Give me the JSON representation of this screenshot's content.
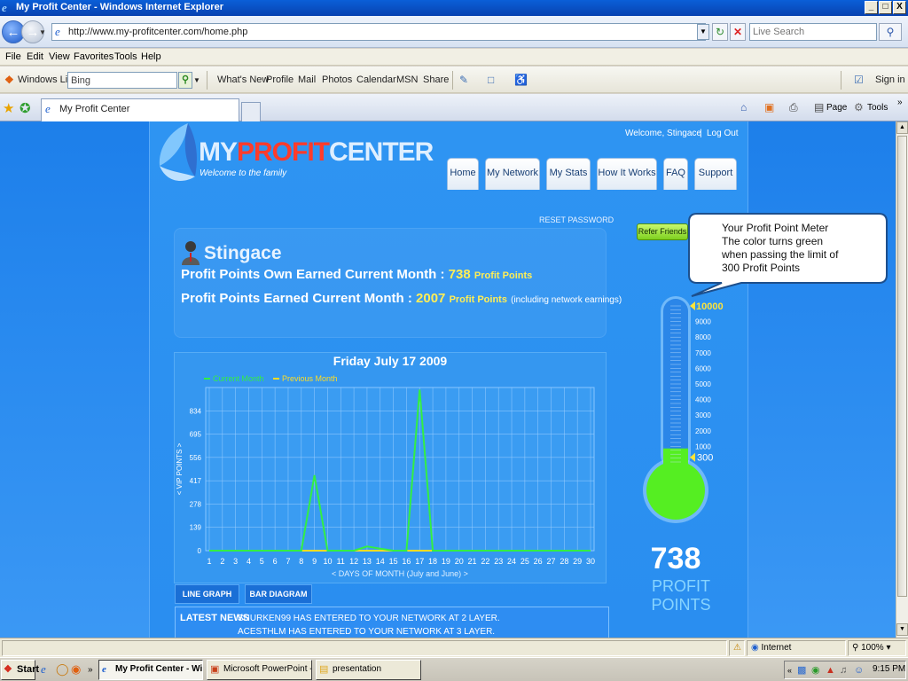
{
  "window": {
    "title": "My Profit Center - Windows Internet Explorer",
    "minimize": "_",
    "restore": "□",
    "close": "X"
  },
  "address": {
    "url": "http://www.my-profitcenter.com/home.php",
    "search_placeholder": "Live Search"
  },
  "menu": [
    "File",
    "Edit",
    "View",
    "Favorites",
    "Tools",
    "Help"
  ],
  "toolbar": {
    "windows_live": "Windows Live",
    "search_value": "Bing",
    "links": [
      "What's New",
      "Profile",
      "Mail",
      "Photos",
      "Calendar",
      "MSN",
      "Share"
    ],
    "sign_in": "Sign in"
  },
  "tabs": {
    "active": "My Profit Center",
    "page": "Page",
    "tools": "Tools"
  },
  "site": {
    "welcome": "Welcome, Stingace",
    "logout": "Log Out",
    "logo_part1": "MY",
    "logo_part2": "PROFIT",
    "logo_part3": "CENTER",
    "tagline": "Welcome to the family",
    "nav": [
      "Home",
      "My Network",
      "My Stats",
      "How It Works",
      "FAQ",
      "Support"
    ],
    "reset_password": "RESET PASSWORD",
    "refer_friends": "Refer Friends"
  },
  "stats": {
    "username": "Stingace",
    "own_label": "Profit Points Own Earned Current Month :",
    "own_value": "738",
    "own_unit": "Profit Points",
    "total_label": "Profit Points Earned Current Month :",
    "total_value": "2007",
    "total_unit": "Profit Points",
    "total_note": "(including network earnings)"
  },
  "chart_tabs": [
    "LINE GRAPH",
    "BAR DIAGRAM"
  ],
  "news": {
    "label": "LATEST NEWS",
    "items": [
      "SNURKEN99 HAS ENTERED TO YOUR NETWORK AT 2 LAYER.",
      "ACESTHLM HAS ENTERED TO YOUR NETWORK AT 3 LAYER."
    ]
  },
  "meter": {
    "value": "738",
    "label": "PROFIT POINTS",
    "level_value": 300,
    "max": 10000,
    "top_label": "10000",
    "marker_label": "300",
    "ticks": [
      "9000",
      "8000",
      "7000",
      "6000",
      "5000",
      "4000",
      "3000",
      "2000",
      "1000"
    ],
    "fill_color": "#55ee22"
  },
  "callout": {
    "lines": [
      "Your Profit Point Meter",
      "The color turns green",
      "when passing the limit of",
      "300 Profit Points"
    ]
  },
  "status": {
    "zone": "Internet",
    "zoom": "100%"
  },
  "taskbar": {
    "start": "Start",
    "tasks": [
      "My Profit Center - Wi...",
      "Microsoft PowerPoint - [...",
      "presentation"
    ],
    "clock": "9:15 PM"
  },
  "chart_data": {
    "type": "line",
    "title": "Friday July 17 2009",
    "xlabel": "< DAYS OF MONTH (July and June) >",
    "ylabel": "< VIP POINTS >",
    "x": [
      1,
      2,
      3,
      4,
      5,
      6,
      7,
      8,
      9,
      10,
      11,
      12,
      13,
      14,
      15,
      16,
      17,
      18,
      19,
      20,
      21,
      22,
      23,
      24,
      25,
      26,
      27,
      28,
      29,
      30
    ],
    "yticks": [
      0,
      139,
      278,
      417,
      556,
      695,
      834
    ],
    "ylim": [
      0,
      973
    ],
    "legend_position": "top-left",
    "grid": true,
    "series": [
      {
        "name": "Current Month",
        "color": "#33ee44",
        "values": [
          0,
          0,
          0,
          0,
          0,
          0,
          0,
          0,
          450,
          0,
          0,
          0,
          25,
          12,
          0,
          0,
          960,
          0,
          0,
          0,
          0,
          0,
          0,
          0,
          0,
          0,
          0,
          0,
          0,
          0
        ]
      },
      {
        "name": "Previous Month",
        "color": "#ffdd22",
        "values": [
          0,
          0,
          0,
          0,
          0,
          0,
          0,
          0,
          0,
          0,
          0,
          0,
          0,
          0,
          0,
          0,
          0,
          0,
          0,
          0,
          0,
          0,
          0,
          0,
          0,
          0,
          0,
          0,
          0,
          0
        ]
      }
    ]
  }
}
